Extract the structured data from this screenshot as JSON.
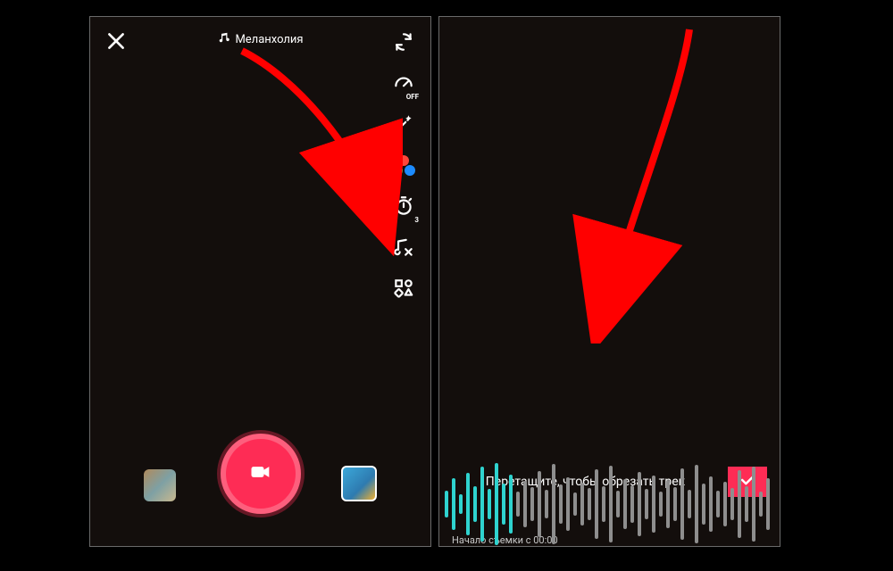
{
  "colors": {
    "accent": "#fe2c55",
    "wave_played": "#2fd3cf",
    "wave_future": "#8e8e8e",
    "arrow": "#ff0000"
  },
  "left": {
    "sound_name": "Меланхолия",
    "tools": {
      "flip": {
        "name": "flip-camera-icon"
      },
      "speed": {
        "name": "speed-icon",
        "sub": "OFF"
      },
      "beauty": {
        "name": "beauty-wand-icon"
      },
      "filter": {
        "name": "filters-icon"
      },
      "timer": {
        "name": "timer-icon",
        "sub": "3"
      },
      "trim": {
        "name": "trim-sound-icon"
      },
      "more": {
        "name": "more-grid-icon"
      }
    }
  },
  "right": {
    "trim_title": "Перетащите, чтобы обрезать трек",
    "start_label": "Начало съемки с 00:00",
    "waveform": {
      "heights": [
        30,
        58,
        22,
        70,
        40,
        84,
        34,
        92,
        46,
        66,
        28,
        52,
        38,
        74,
        32,
        90,
        44,
        60,
        26,
        48,
        36,
        78,
        40,
        86,
        30,
        56,
        42,
        72,
        34,
        64,
        28,
        54,
        38,
        80,
        32,
        88,
        46,
        62,
        30,
        50,
        36,
        76,
        40,
        84,
        28,
        58
      ],
      "played_count": 10
    }
  }
}
